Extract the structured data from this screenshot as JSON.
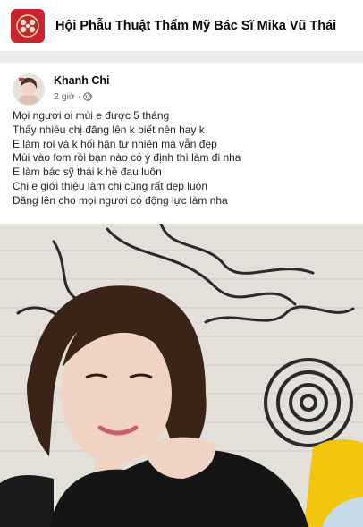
{
  "group": {
    "name": "Hội Phẫu Thuật Thẩm Mỹ Bác Sĩ Mika Vũ Thái"
  },
  "post": {
    "author": "Khanh Chi",
    "time": "2 giờ",
    "separator": "·",
    "privacy_icon": "globe-icon",
    "lines": [
      "Mọi ngươi oi mùi e được 5 tháng",
      "Thấy nhiều chị đăng lên k biết nên hay k",
      "E làm roi và k hối hận tự nhiên mà vẫn đẹp",
      "Mùi vào fom rồi bạn nào có ý định thì làm đi nha",
      "E làm bác sỹ thái k hề đau luôn",
      "Chị e giới thiệu làm chị cũng rất đẹp luôn",
      "Đăng lên cho mọi ngươi có động lực làm nha"
    ]
  },
  "colors": {
    "brand_red": "#c8242d",
    "meta_gray": "#65676b"
  }
}
